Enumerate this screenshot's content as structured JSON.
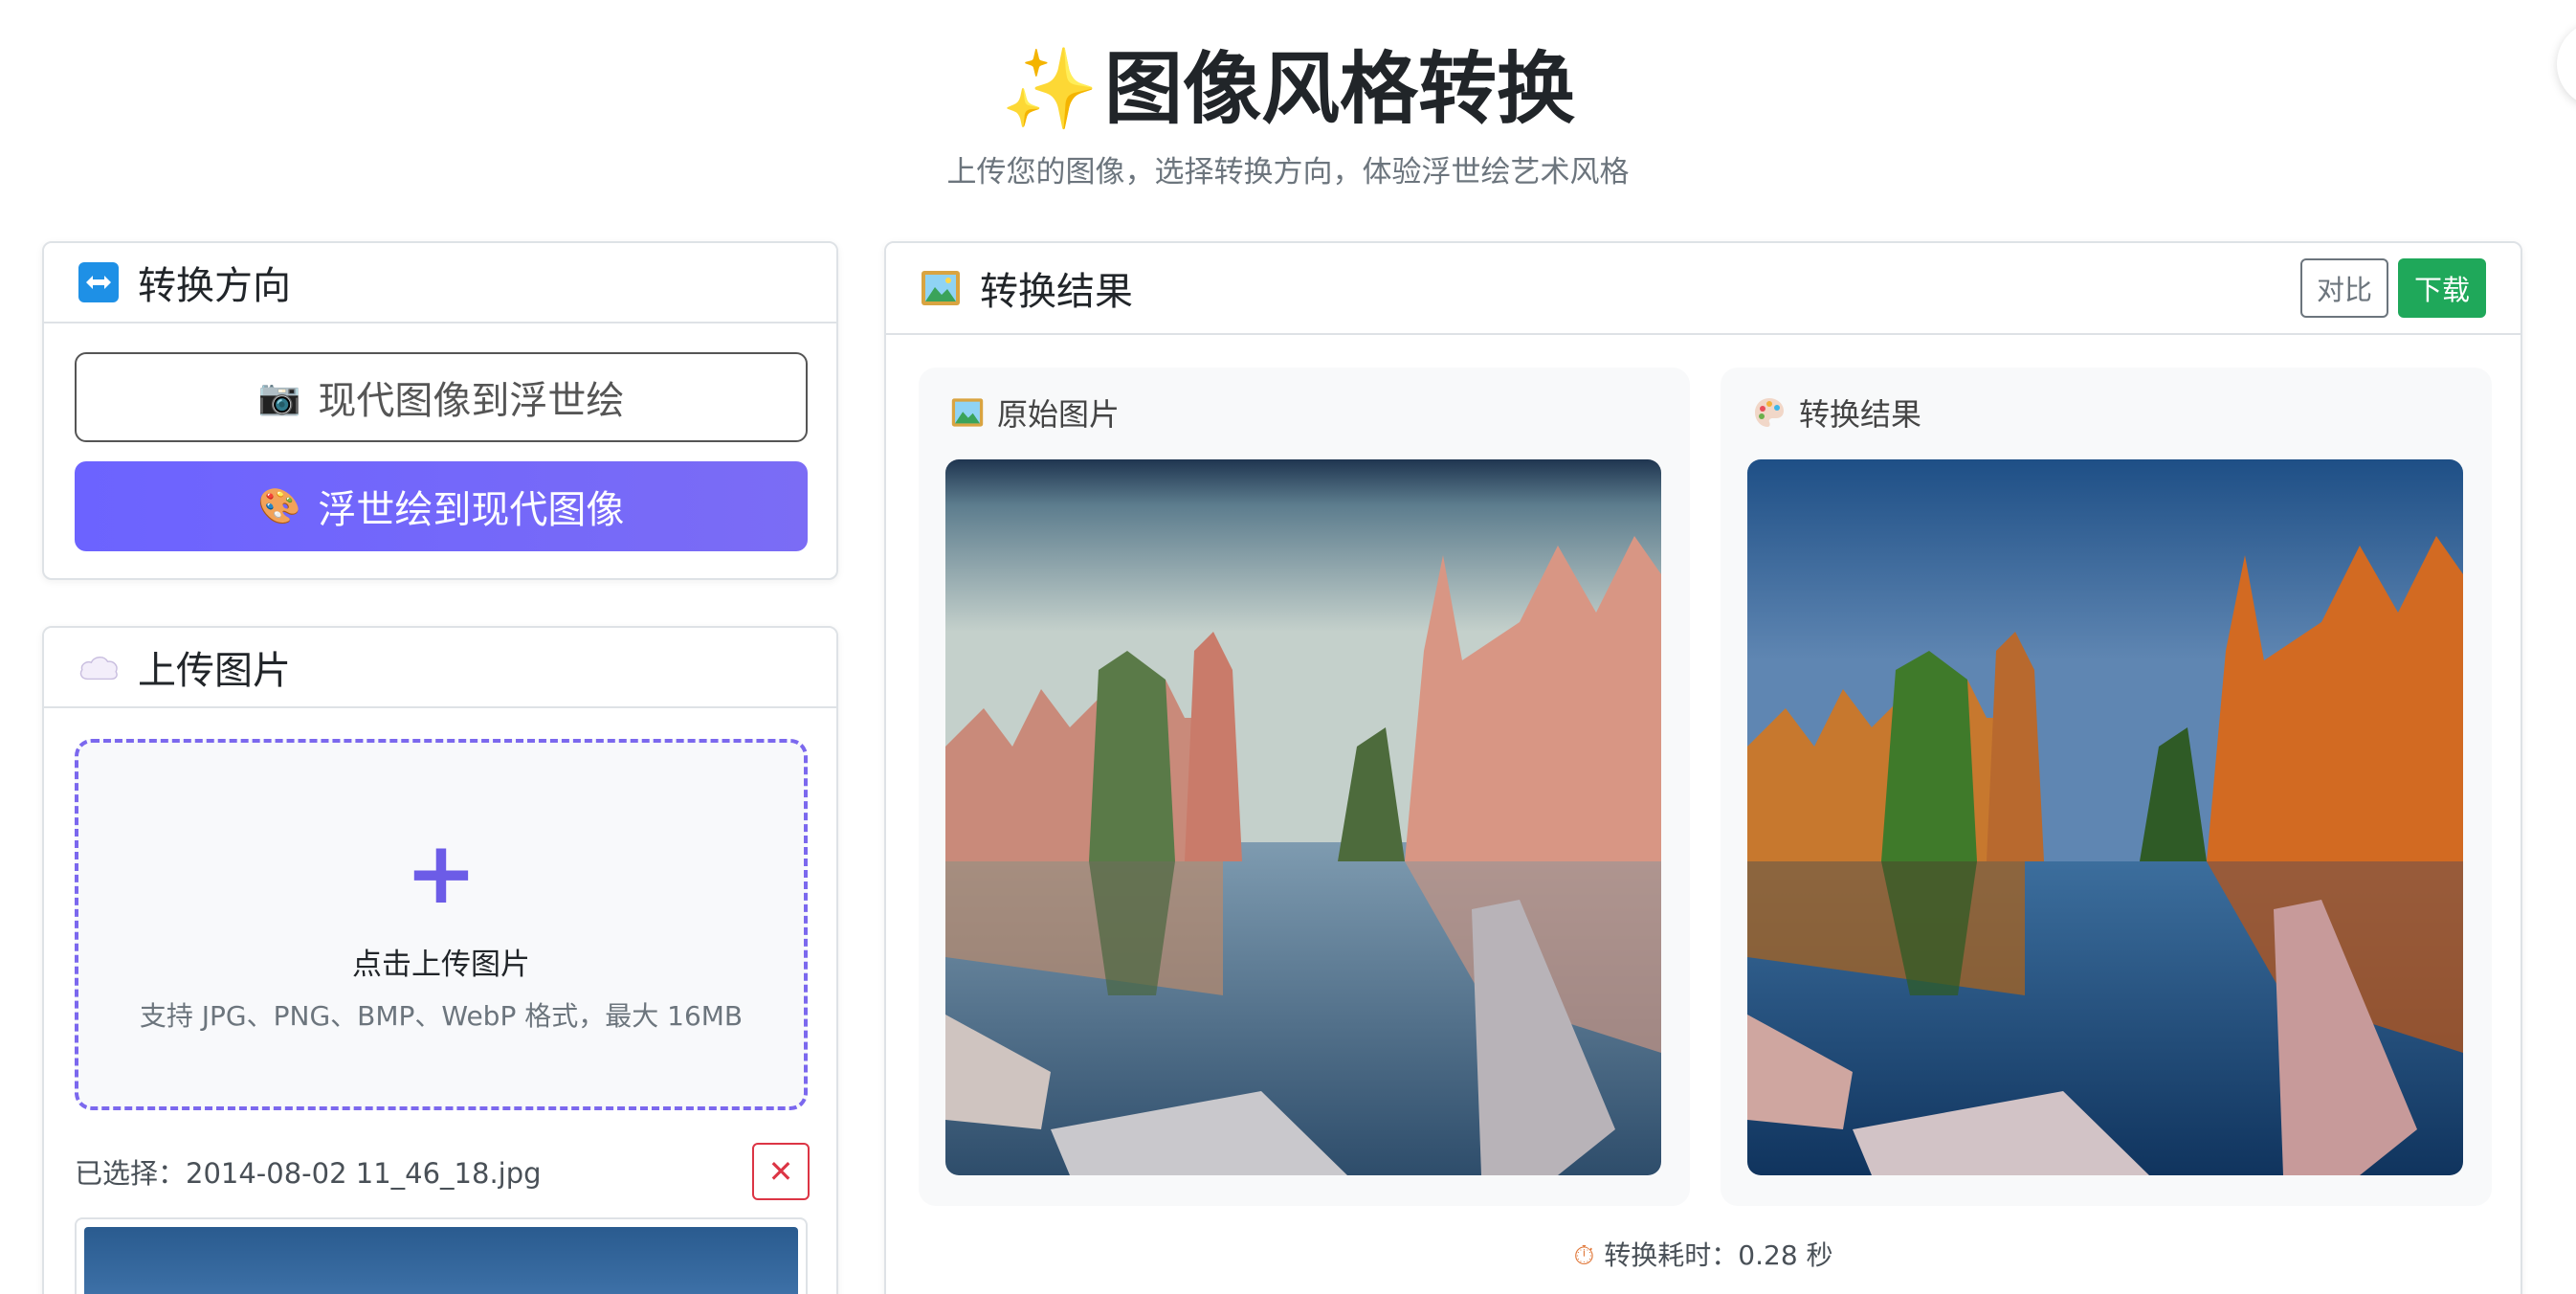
{
  "header": {
    "title": "图像风格转换",
    "subtitle": "上传您的图像，选择转换方向，体验浮世绘艺术风格"
  },
  "direction": {
    "title": "转换方向",
    "option_modern": "现代图像到浮世绘",
    "option_ukiyoe": "浮世绘到现代图像",
    "selected": "浮世绘到现代图像"
  },
  "upload": {
    "title": "上传图片",
    "dropzone_title": "点击上传图片",
    "dropzone_hint": "支持 JPG、PNG、BMP、WebP 格式，最大 16MB",
    "selected_file": "已选择：2014-08-02 11_46_18.jpg"
  },
  "result": {
    "title": "转换结果",
    "compare_label": "对比",
    "download_label": "下载",
    "original_label": "原始图片",
    "result_label": "转换结果",
    "timing": "转换耗时：0.28 秒"
  },
  "colors": {
    "accent": "#6c63ff",
    "success": "#1fa85a",
    "danger": "#dc3545"
  }
}
